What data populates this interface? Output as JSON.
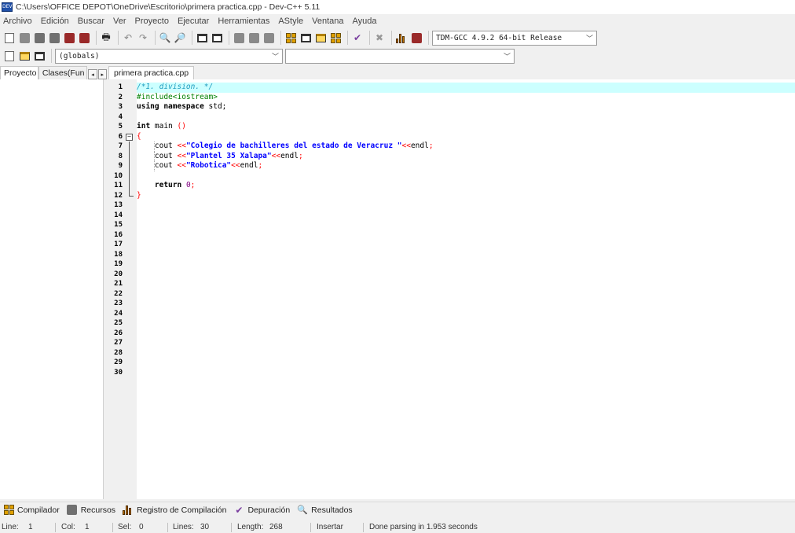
{
  "window": {
    "title": "C:\\Users\\OFFICE DEPOT\\OneDrive\\Escritorio\\primera practica.cpp - Dev-C++ 5.11",
    "logo_text": "DEV"
  },
  "menu": [
    "Archivo",
    "Edición",
    "Buscar",
    "Ver",
    "Proyecto",
    "Ejecutar",
    "Herramientas",
    "AStyle",
    "Ventana",
    "Ayuda"
  ],
  "toolbar": {
    "compiler": "TDM-GCC 4.9.2 64-bit Release",
    "scope": "(globals)",
    "symbol": ""
  },
  "left_panel": {
    "tabs": [
      "Proyecto",
      "Clases(Fun"
    ],
    "scroll_left": "◂",
    "scroll_right": "▸"
  },
  "editor": {
    "file_tab": "primera practica.cpp",
    "line_numbers": [
      "1",
      "2",
      "3",
      "4",
      "5",
      "6",
      "7",
      "8",
      "9",
      "10",
      "11",
      "12",
      "13",
      "14",
      "15",
      "16",
      "17",
      "18",
      "19",
      "20",
      "21",
      "22",
      "23",
      "24",
      "25",
      "26",
      "27",
      "28",
      "29",
      "30"
    ],
    "code": {
      "l1": "/*1. division. */",
      "l2": "#include<iostream>",
      "l3_kw": "using namespace",
      "l3_rest": " std;",
      "l5_kw": "int",
      "l5_rest": " main ",
      "l5_sym": "()",
      "l6": "{",
      "l7_a": "cout ",
      "l7_op": "<<",
      "l7_str": "\"Colegio de bachilleres del estado de Veracruz \"",
      "l7_op2": "<<",
      "l7_end": "endl",
      "l7_semi": ";",
      "l8_a": "cout ",
      "l8_op": "<<",
      "l8_str": "\"Plantel 35 Xalapa\"",
      "l8_op2": "<<",
      "l8_end": "endl",
      "l8_semi": ";",
      "l9_a": "cout ",
      "l9_op": "<<",
      "l9_str": "\"Robotica\"",
      "l9_op2": "<<",
      "l9_end": "endl",
      "l9_semi": ";",
      "l11_kw": "return",
      "l11_num": " 0",
      "l11_semi": ";",
      "l12": "}"
    }
  },
  "bottom_tabs": [
    "Compilador",
    "Recursos",
    "Registro de Compilación",
    "Depuración",
    "Resultados"
  ],
  "status": {
    "line_label": "Line:",
    "line_value": "1",
    "col_label": "Col:",
    "col_value": "1",
    "sel_label": "Sel:",
    "sel_value": "0",
    "lines_label": "Lines:",
    "lines_value": "30",
    "length_label": "Length:",
    "length_value": "268",
    "mode": "Insertar",
    "message": "Done parsing in 1.953 seconds"
  },
  "colors": {
    "highlight_line": "#ccffff",
    "comment": "#1e9bbf",
    "preprocessor": "#008000",
    "string": "#0000ff",
    "symbol": "#ff0000",
    "number": "#800080"
  }
}
